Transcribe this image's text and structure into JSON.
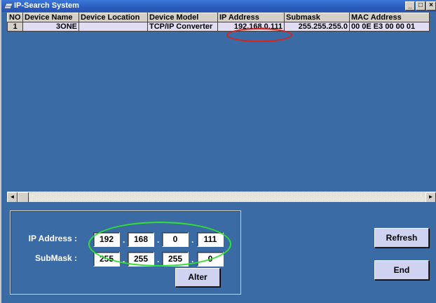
{
  "window": {
    "title": "IP-Search System",
    "controls": {
      "minimize": "_",
      "maximize": "□",
      "close": "×"
    }
  },
  "grid": {
    "columns": [
      "NO",
      "Device Name",
      "Device Location",
      "Device Model",
      "IP Address",
      "Submask",
      "MAC Address"
    ],
    "rows": [
      {
        "no": "1",
        "name": "3ONE",
        "location": "",
        "model": "TCP/IP Converter",
        "ip": "192.168.0.111",
        "submask": "255.255.255.0",
        "mac": "00 0E E3 00 00 01"
      }
    ]
  },
  "scrollbar": {
    "left_arrow": "◄",
    "right_arrow": "►"
  },
  "form": {
    "ip_label": "IP Address :",
    "ip": [
      "192",
      "168",
      "0",
      "111"
    ],
    "submask_label": "SubMask :",
    "submask": [
      "255",
      "255",
      "255",
      "0"
    ],
    "separator": ".",
    "alter_label": "Alter"
  },
  "buttons": {
    "refresh": "Refresh",
    "end": "End"
  },
  "colors": {
    "background": "#3a6ba5",
    "highlight_red": "#e0201a",
    "highlight_green": "#30e030"
  }
}
